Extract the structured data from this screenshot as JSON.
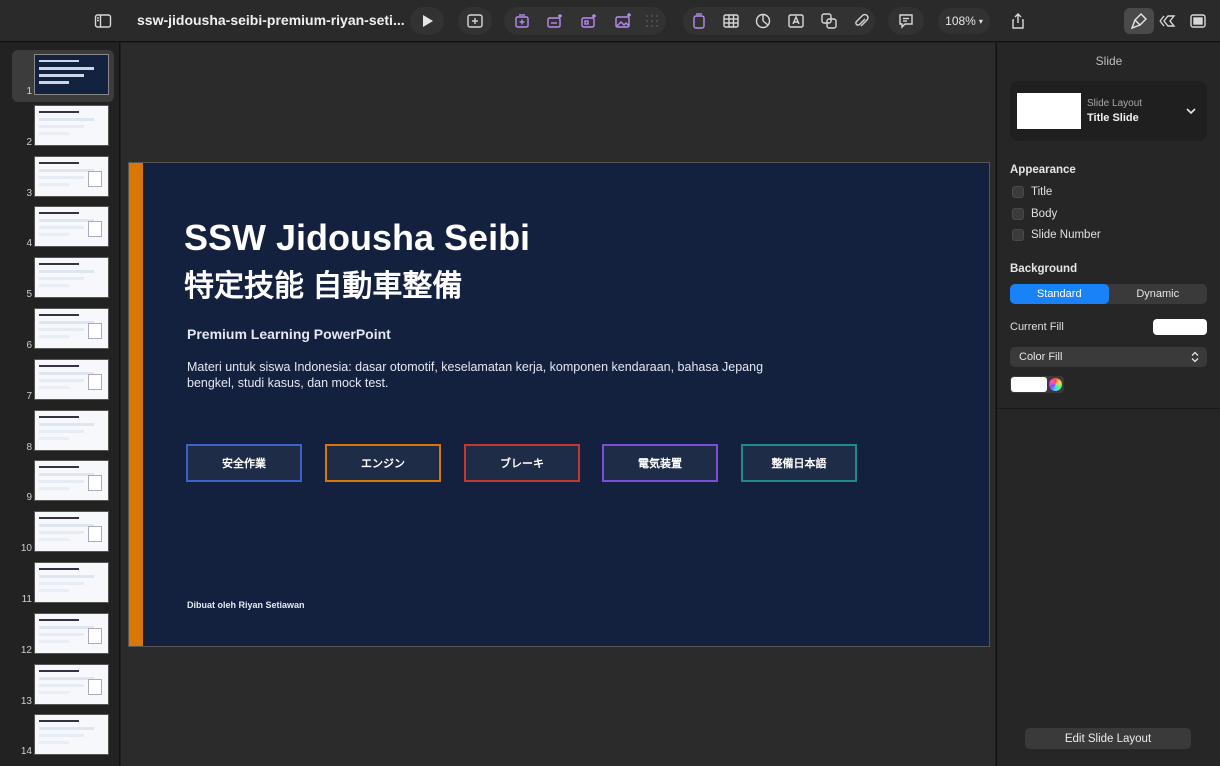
{
  "toolbar": {
    "doc_title": "ssw-jidousha-seibi-premium-riyan-seti...",
    "zoom": "108%"
  },
  "navigator": {
    "slides": [
      "1",
      "2",
      "3",
      "4",
      "5",
      "6",
      "7",
      "8",
      "9",
      "10",
      "11",
      "12",
      "13",
      "14"
    ]
  },
  "slide": {
    "title": "SSW Jidousha Seibi",
    "title_jp": "特定技能 自動車整備",
    "subtitle": "Premium Learning PowerPoint",
    "description": "Materi untuk siswa Indonesia: dasar otomotif, keselamatan kerja, komponen kendaraan, bahasa Jepang bengkel, studi kasus, dan mock test.",
    "chips": [
      {
        "label": "安全作業",
        "color": "#3b63c9"
      },
      {
        "label": "エンジン",
        "color": "#d97706"
      },
      {
        "label": "ブレーキ",
        "color": "#c0392b"
      },
      {
        "label": "電気装置",
        "color": "#7c4dd6"
      },
      {
        "label": "整備日本語",
        "color": "#1e8a8a"
      }
    ],
    "author": "Dibuat oleh Riyan Setiawan",
    "accent_color": "#d97706",
    "background_color": "#13213f"
  },
  "inspector": {
    "header": "Slide",
    "layout_label": "Slide Layout",
    "layout_name": "Title Slide",
    "appearance_label": "Appearance",
    "appearance_items": [
      "Title",
      "Body",
      "Slide Number"
    ],
    "background_label": "Background",
    "segments": [
      "Standard",
      "Dynamic"
    ],
    "current_fill_label": "Current Fill",
    "fill_type": "Color Fill",
    "edit_layout_button": "Edit Slide Layout",
    "accent_color": "#1a82f7"
  }
}
